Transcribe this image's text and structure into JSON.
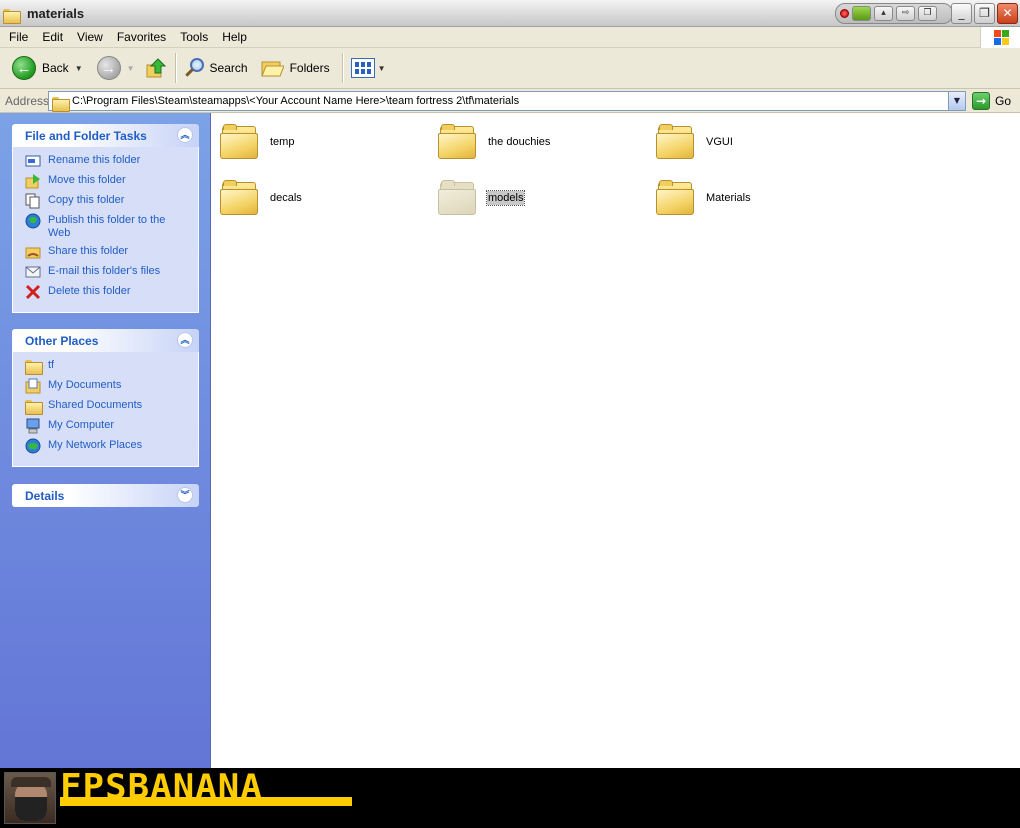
{
  "window": {
    "title": "materials",
    "controls": {
      "minimize": "_",
      "maximize": "❐",
      "close": "✕"
    }
  },
  "menubar": {
    "items": [
      "File",
      "Edit",
      "View",
      "Favorites",
      "Tools",
      "Help"
    ]
  },
  "toolbar": {
    "back_label": "Back",
    "search_label": "Search",
    "folders_label": "Folders"
  },
  "addressbar": {
    "label": "Address",
    "value": "C:\\Program Files\\Steam\\steamapps\\<Your Account Name Here>\\team fortress 2\\tf\\materials",
    "go_label": "Go"
  },
  "sidebar": {
    "tasks": {
      "title": "File and Folder Tasks",
      "items": [
        {
          "label": "Rename this folder",
          "icon": "rename-icon"
        },
        {
          "label": "Move this folder",
          "icon": "move-icon"
        },
        {
          "label": "Copy this folder",
          "icon": "copy-icon"
        },
        {
          "label": "Publish this folder to the Web",
          "icon": "publish-web-icon"
        },
        {
          "label": "Share this folder",
          "icon": "share-icon"
        },
        {
          "label": "E-mail this folder's files",
          "icon": "email-icon"
        },
        {
          "label": "Delete this folder",
          "icon": "delete-icon"
        }
      ]
    },
    "places": {
      "title": "Other Places",
      "items": [
        {
          "label": "tf",
          "icon": "folder-icon"
        },
        {
          "label": "My Documents",
          "icon": "my-documents-icon"
        },
        {
          "label": "Shared Documents",
          "icon": "folder-icon"
        },
        {
          "label": "My Computer",
          "icon": "my-computer-icon"
        },
        {
          "label": "My Network Places",
          "icon": "network-places-icon"
        }
      ]
    },
    "details": {
      "title": "Details"
    }
  },
  "content": {
    "folders": [
      {
        "name": "temp",
        "selected": false
      },
      {
        "name": "the douchies",
        "selected": false
      },
      {
        "name": "VGUI",
        "selected": false
      },
      {
        "name": "decals",
        "selected": false
      },
      {
        "name": "models",
        "selected": true
      },
      {
        "name": "Materials",
        "selected": false
      }
    ]
  },
  "banner": {
    "logo_text": "FPSBANANA"
  },
  "colors": {
    "sidebar_gradient_top": "#7ba2e7",
    "sidebar_gradient_bottom": "#6375d6",
    "panel_link": "#215dc6",
    "logo": "#ffcc00"
  }
}
